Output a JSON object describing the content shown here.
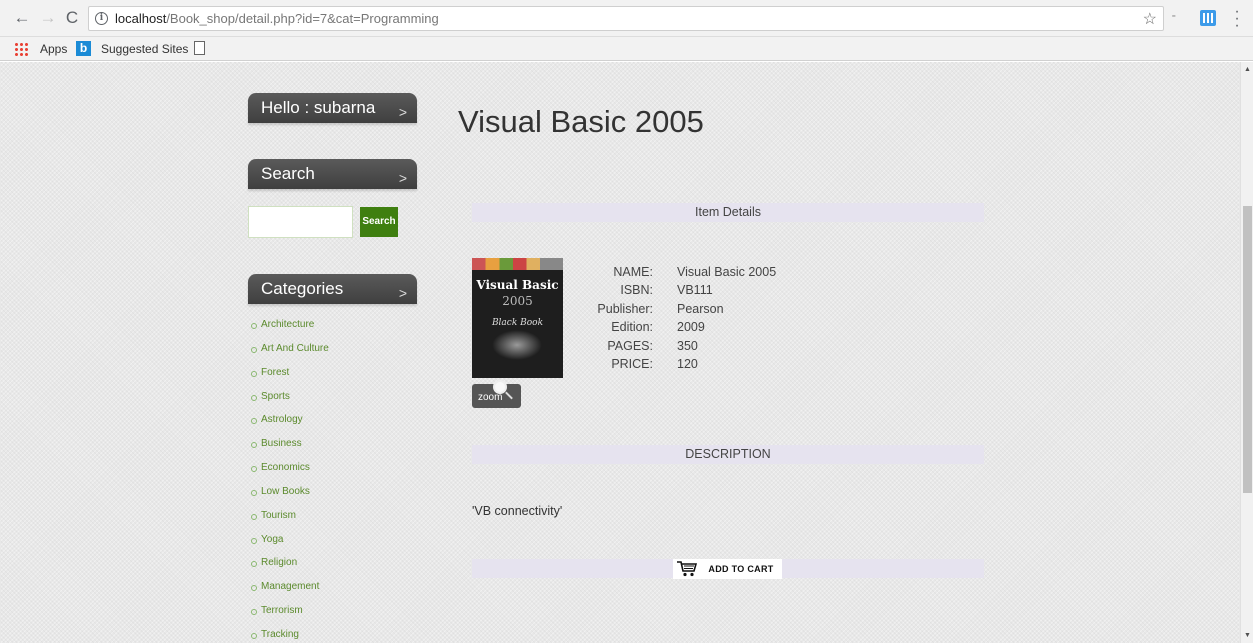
{
  "browser": {
    "url_host": "localhost",
    "url_path": "/Book_shop/detail.php?id=7&cat=Programming",
    "bookmarks": {
      "apps": "Apps",
      "suggested": "Suggested Sites"
    }
  },
  "sidebar": {
    "greeting": "Hello : subarna",
    "search_heading": "Search",
    "search_value": "",
    "search_button": "Search",
    "categories_heading": "Categories",
    "chevron": ">",
    "categories": [
      "Architecture",
      "Art And Culture",
      "Forest",
      "Sports",
      "Astrology",
      "Business",
      "Economics",
      "Low Books",
      "Tourism",
      "Yoga",
      "Religion",
      "Management",
      "Terrorism",
      "Tracking"
    ]
  },
  "book": {
    "title": "Visual Basic 2005",
    "item_details_heading": "Item Details",
    "cover": {
      "line1": "Visual Basic",
      "line2": "2005",
      "line3": "Black Book"
    },
    "zoom_label": "zoom",
    "fields": [
      {
        "label": "NAME:",
        "value": "Visual Basic 2005"
      },
      {
        "label": "ISBN:",
        "value": "VB111"
      },
      {
        "label": "Publisher:",
        "value": "Pearson"
      },
      {
        "label": "Edition:",
        "value": "2009"
      },
      {
        "label": "PAGES:",
        "value": "350"
      },
      {
        "label": "PRICE:",
        "value": "120"
      }
    ],
    "description_heading": "DESCRIPTION",
    "description": "'VB connectivity'",
    "add_to_cart": "ADD TO CART"
  }
}
